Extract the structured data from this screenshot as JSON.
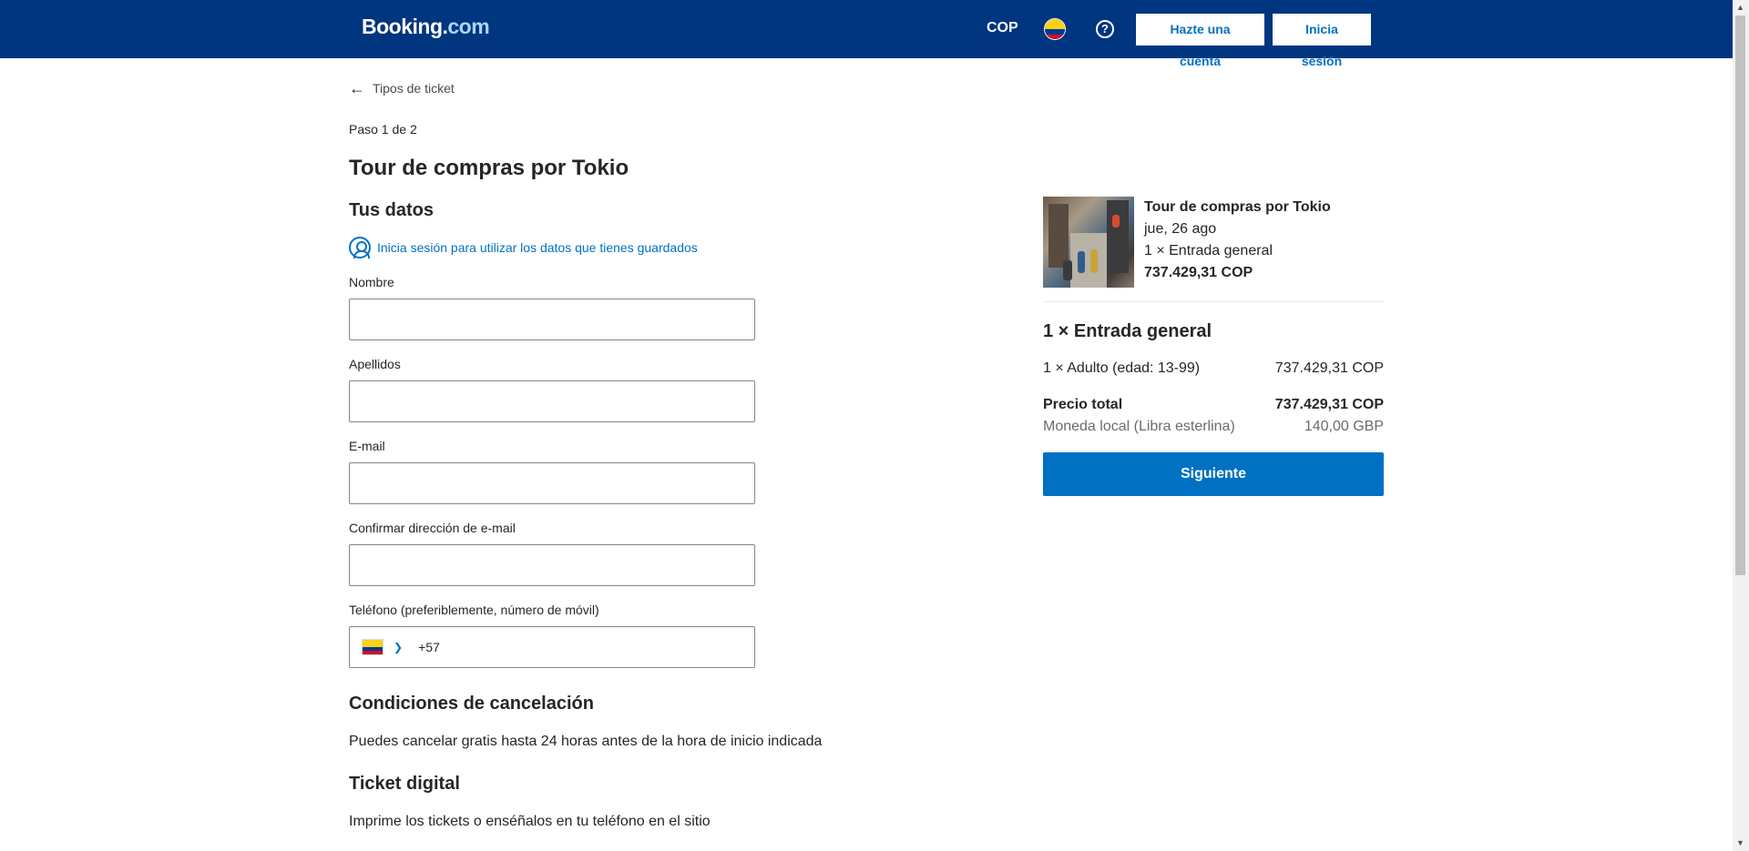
{
  "header": {
    "logo_text": "Booking",
    "logo_dot": ".",
    "logo_com": "com",
    "currency": "COP",
    "help_icon_glyph": "?",
    "register_label": "Hazte una cuenta",
    "login_label": "Inicia sesión"
  },
  "icons": {
    "back": "arrow-left-icon",
    "help": "question-circle-icon",
    "user": "user-circle-icon",
    "chevron": "chevron-down-icon",
    "flag": "colombia-flag-icon"
  },
  "form": {
    "back_label": "Tipos de ticket",
    "step": "Paso 1 de 2",
    "title": "Tour de compras por Tokio",
    "section_title": "Tus datos",
    "signin_label": "Inicia sesión para utilizar los datos que tienes guardados",
    "first_name_label": "Nombre",
    "first_name_value": "",
    "last_name_label": "Apellidos",
    "last_name_value": "",
    "email_label": "E-mail",
    "email_value": "",
    "confirm_email_label": "Confirmar dirección de e-mail",
    "confirm_email_value": "",
    "phone_label": "Teléfono (preferiblemente, número de móvil)",
    "phone_code": "+57",
    "cancellation_title": "Condiciones de cancelación",
    "cancellation_text": "Puedes cancelar gratis hasta 24 horas antes de la hora de inicio indicada",
    "ticket_title": "Ticket digital",
    "ticket_text": "Imprime los tickets o enséñalos en tu teléfono en el sitio"
  },
  "summary": {
    "title": "Tour de compras por Tokio",
    "date": "jue, 26 ago",
    "ticket_line": "1 × Entrada general",
    "price": "737.429,31 COP",
    "ticket_heading": "1 × Entrada general",
    "adult_label": "1 × Adulto (edad: 13-99)",
    "adult_price": "737.429,31 COP",
    "total_label": "Precio total",
    "total_value": "737.429,31 COP",
    "local_label": "Moneda local (Libra esterlina)",
    "local_value": "140,00 GBP",
    "next_label": "Siguiente"
  },
  "colors": {
    "header_bg": "#003580",
    "accent": "#0071c2",
    "text": "#262626"
  }
}
